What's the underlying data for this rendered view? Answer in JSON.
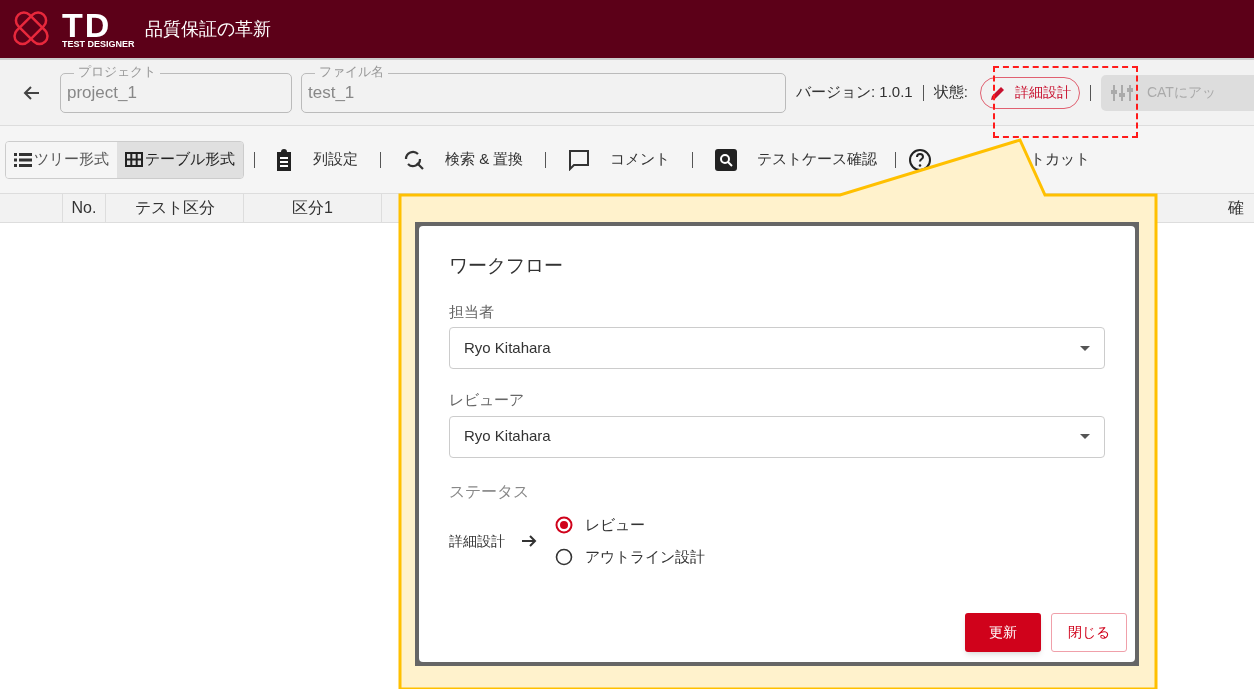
{
  "app": {
    "logo": "TD",
    "logo_sub": "TEST DESIGNER",
    "tagline": "品質保証の革新"
  },
  "info_bar": {
    "project": {
      "label": "プロジェクト",
      "value": "project_1"
    },
    "file": {
      "label": "ファイル名",
      "value": "test_1"
    },
    "version": "バージョン: 1.0.1",
    "status_label": "状態:",
    "status": "詳細設計",
    "upload": "CATにアッ"
  },
  "toolbar": {
    "views": [
      {
        "label": "ツリー形式",
        "selected": false,
        "kind": "tree"
      },
      {
        "label": "テーブル形式",
        "selected": true,
        "kind": "table"
      }
    ],
    "actions": [
      {
        "kind": "columns",
        "label": "列設定"
      },
      {
        "kind": "replace",
        "label": "検索 & 置換"
      },
      {
        "kind": "comment",
        "label": "コメント"
      },
      {
        "kind": "testcase",
        "label": "テストケース確認"
      },
      {
        "kind": "help",
        "label": "トカット"
      }
    ]
  },
  "table": {
    "columns": [
      "No.",
      "テスト区分",
      "区分1",
      "確"
    ]
  },
  "dialog": {
    "title": "ワークフロー",
    "fields": [
      {
        "label": "担当者",
        "value": "Ryo Kitahara"
      },
      {
        "label": "レビューア",
        "value": "Ryo Kitahara"
      }
    ],
    "status": {
      "label": "ステータス",
      "current": "詳細設計",
      "options": [
        {
          "label": "レビュー",
          "selected": true
        },
        {
          "label": "アウトライン設計",
          "selected": false
        }
      ]
    },
    "buttons": [
      {
        "label": "更新",
        "kind": "primary"
      },
      {
        "label": "閉じる",
        "kind": "secondary"
      }
    ]
  }
}
